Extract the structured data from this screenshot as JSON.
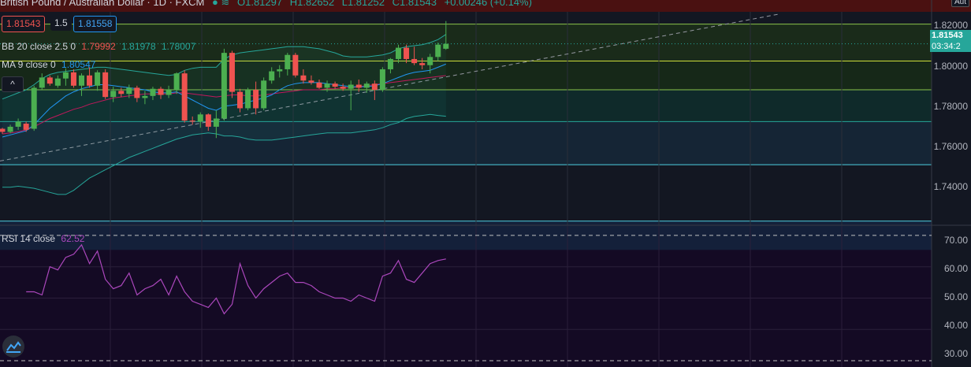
{
  "header": {
    "symbol": "British Pound / Australian Dollar · 1D · FXCM",
    "open": "O1.81297",
    "high": "H1.82652",
    "low": "L1.81252",
    "close": "C1.81543",
    "change": "+0.00246 (+0.14%)"
  },
  "price_boxes": {
    "sell": "1.81543",
    "spread": "1.5",
    "buy": "1.81558"
  },
  "indicators": {
    "bb_label": "BB 20 close 2.5 0",
    "bb_basis": "1.79992",
    "bb_upper": "1.81978",
    "bb_lower": "1.78007",
    "ma_label": "MA 9 close 0",
    "ma_value": "1.80547",
    "rsi_label": "RSI 14 close",
    "rsi_value": "62.52"
  },
  "collapse_glyph": "^",
  "top_button": "Aut",
  "price_axis": {
    "ticks": [
      "1.82000",
      "1.80000",
      "1.78000",
      "1.76000",
      "1.74000"
    ],
    "current_price": "1.81543",
    "countdown": "03:34:2"
  },
  "rsi_axis": {
    "ticks": [
      "70.00",
      "60.00",
      "50.00",
      "40.00",
      "30.00"
    ]
  },
  "colors": {
    "up": "#4caf50",
    "down": "#ef5350",
    "bb": "#26a69a",
    "ma": "#2196f3",
    "rsi": "#ab47bc",
    "rsi_bg": "#140a24",
    "bg": "#131722"
  },
  "chart_data": {
    "type": "candlestick",
    "price_range": [
      1.727,
      1.831
    ],
    "candles": [
      [
        1.774,
        1.7745,
        1.7715,
        1.7725
      ],
      [
        1.7725,
        1.776,
        1.7718,
        1.775
      ],
      [
        1.775,
        1.779,
        1.7735,
        1.7775
      ],
      [
        1.7765,
        1.7775,
        1.7725,
        1.7735
      ],
      [
        1.774,
        1.795,
        1.773,
        1.794
      ],
      [
        1.794,
        1.801,
        1.793,
        1.799
      ],
      [
        1.799,
        1.8,
        1.795,
        1.796
      ],
      [
        1.795,
        1.8,
        1.794,
        1.7985
      ],
      [
        1.7985,
        1.8035,
        1.795,
        1.8015
      ],
      [
        1.8015,
        1.803,
        1.794,
        1.795
      ],
      [
        1.795,
        1.801,
        1.79,
        1.8
      ],
      [
        1.8,
        1.804,
        1.794,
        1.795
      ],
      [
        1.795,
        1.8025,
        1.7925,
        1.8015
      ],
      [
        1.8015,
        1.803,
        1.7885,
        1.7895
      ],
      [
        1.7895,
        1.7945,
        1.787,
        1.7925
      ],
      [
        1.7925,
        1.794,
        1.7895,
        1.791
      ],
      [
        1.791,
        1.7955,
        1.789,
        1.794
      ],
      [
        1.794,
        1.795,
        1.787,
        1.789
      ],
      [
        1.789,
        1.7925,
        1.786,
        1.79
      ],
      [
        1.79,
        1.7945,
        1.788,
        1.7935
      ],
      [
        1.7935,
        1.7945,
        1.7885,
        1.7905
      ],
      [
        1.7905,
        1.795,
        1.789,
        1.793
      ],
      [
        1.793,
        1.8015,
        1.791,
        1.801
      ],
      [
        1.801,
        1.8025,
        1.777,
        1.778
      ],
      [
        1.778,
        1.78,
        1.776,
        1.7775
      ],
      [
        1.7775,
        1.782,
        1.7745,
        1.781
      ],
      [
        1.781,
        1.7815,
        1.773,
        1.775
      ],
      [
        1.775,
        1.783,
        1.7695,
        1.779
      ],
      [
        1.779,
        1.813,
        1.778,
        1.811
      ],
      [
        1.811,
        1.812,
        1.789,
        1.792
      ],
      [
        1.792,
        1.7935,
        1.782,
        1.784
      ],
      [
        1.784,
        1.794,
        1.783,
        1.793
      ],
      [
        1.793,
        1.797,
        1.781,
        1.784
      ],
      [
        1.784,
        1.799,
        1.783,
        1.7975
      ],
      [
        1.7975,
        1.804,
        1.796,
        1.802
      ],
      [
        1.802,
        1.805,
        1.799,
        1.803
      ],
      [
        1.803,
        1.811,
        1.8,
        1.81
      ],
      [
        1.81,
        1.811,
        1.799,
        1.8
      ],
      [
        1.8,
        1.803,
        1.796,
        1.7975
      ],
      [
        1.7975,
        1.8,
        1.7955,
        1.7965
      ],
      [
        1.7965,
        1.798,
        1.7935,
        1.794
      ],
      [
        1.794,
        1.7975,
        1.792,
        1.796
      ],
      [
        1.796,
        1.797,
        1.7935,
        1.7945
      ],
      [
        1.7945,
        1.796,
        1.7925,
        1.7935
      ],
      [
        1.7935,
        1.7975,
        1.783,
        1.7955
      ],
      [
        1.7955,
        1.798,
        1.792,
        1.794
      ],
      [
        1.794,
        1.797,
        1.7915,
        1.796
      ],
      [
        1.796,
        1.7975,
        1.788,
        1.793
      ],
      [
        1.793,
        1.804,
        1.792,
        1.803
      ],
      [
        1.803,
        1.8085,
        1.801,
        1.808
      ],
      [
        1.808,
        1.815,
        1.806,
        1.8135
      ],
      [
        1.8135,
        1.815,
        1.806,
        1.808
      ],
      [
        1.808,
        1.814,
        1.805,
        1.806
      ],
      [
        1.806,
        1.8085,
        1.803,
        1.805
      ],
      [
        1.805,
        1.8105,
        1.801,
        1.809
      ],
      [
        1.809,
        1.816,
        1.807,
        1.815
      ],
      [
        1.813,
        1.8265,
        1.8125,
        1.8154
      ]
    ],
    "bb_upper": [
      1.7885,
      1.79,
      1.7915,
      1.793,
      1.7955,
      1.7985,
      1.8005,
      1.8015,
      1.802,
      1.8025,
      1.803,
      1.8035,
      1.804,
      1.804,
      1.8035,
      1.803,
      1.8025,
      1.802,
      1.8015,
      1.801,
      1.8005,
      1.8,
      1.8005,
      1.8025,
      1.8035,
      1.804,
      1.804,
      1.804,
      1.808,
      1.81,
      1.811,
      1.8115,
      1.812,
      1.8125,
      1.813,
      1.8135,
      1.814,
      1.814,
      1.814,
      1.8135,
      1.813,
      1.812,
      1.811,
      1.8095,
      1.809,
      1.809,
      1.809,
      1.8095,
      1.81,
      1.811,
      1.813,
      1.814,
      1.8145,
      1.815,
      1.816,
      1.8175,
      1.82
    ],
    "bb_basis": [
      1.7715,
      1.772,
      1.7725,
      1.7735,
      1.775,
      1.777,
      1.779,
      1.7805,
      1.782,
      1.7835,
      1.7845,
      1.786,
      1.787,
      1.788,
      1.789,
      1.7895,
      1.79,
      1.7905,
      1.791,
      1.791,
      1.791,
      1.791,
      1.7915,
      1.7915,
      1.791,
      1.7905,
      1.79,
      1.7895,
      1.79,
      1.7905,
      1.7905,
      1.79,
      1.79,
      1.7905,
      1.791,
      1.7915,
      1.792,
      1.7925,
      1.793,
      1.793,
      1.793,
      1.7935,
      1.7935,
      1.794,
      1.794,
      1.7945,
      1.795,
      1.7955,
      1.796,
      1.7965,
      1.797,
      1.7975,
      1.798,
      1.7985,
      1.799,
      1.7995,
      1.7999
    ],
    "bb_lower": [
      1.7455,
      1.7455,
      1.746,
      1.7455,
      1.745,
      1.744,
      1.743,
      1.742,
      1.742,
      1.744,
      1.747,
      1.75,
      1.752,
      1.754,
      1.756,
      1.758,
      1.76,
      1.7615,
      1.763,
      1.7645,
      1.766,
      1.7675,
      1.769,
      1.77,
      1.771,
      1.7715,
      1.772,
      1.7715,
      1.7705,
      1.7705,
      1.77,
      1.769,
      1.7685,
      1.7685,
      1.7685,
      1.769,
      1.7695,
      1.77,
      1.7705,
      1.771,
      1.7715,
      1.772,
      1.772,
      1.772,
      1.772,
      1.7725,
      1.773,
      1.7735,
      1.7745,
      1.776,
      1.777,
      1.779,
      1.78,
      1.7805,
      1.781,
      1.7805,
      1.7801
    ],
    "ma": [
      1.77,
      1.771,
      1.772,
      1.773,
      1.776,
      1.78,
      1.784,
      1.787,
      1.79,
      1.792,
      1.7935,
      1.7945,
      1.7955,
      1.7955,
      1.795,
      1.7945,
      1.794,
      1.7935,
      1.793,
      1.792,
      1.7915,
      1.7915,
      1.792,
      1.79,
      1.788,
      1.786,
      1.784,
      1.783,
      1.785,
      1.7855,
      1.786,
      1.787,
      1.788,
      1.789,
      1.7905,
      1.793,
      1.795,
      1.796,
      1.7965,
      1.7965,
      1.7965,
      1.796,
      1.7955,
      1.795,
      1.7945,
      1.7945,
      1.7945,
      1.795,
      1.796,
      1.7975,
      1.799,
      1.8005,
      1.8015,
      1.802,
      1.8025,
      1.804,
      1.8055
    ],
    "rsi": [
      52,
      52,
      51,
      60,
      59,
      63,
      64,
      67,
      61,
      65,
      56,
      53,
      54,
      58,
      51,
      53,
      54,
      56,
      51,
      57,
      52,
      49,
      48,
      47,
      50,
      45,
      48,
      61,
      54,
      50,
      53,
      55,
      57,
      58,
      55,
      55,
      54,
      52,
      51,
      50,
      50,
      49,
      51,
      50,
      49,
      57,
      58,
      62,
      56,
      55,
      58,
      61,
      62,
      62.5
    ],
    "rsi_range": [
      28,
      73
    ],
    "rsi_levels": [
      70,
      30
    ]
  }
}
